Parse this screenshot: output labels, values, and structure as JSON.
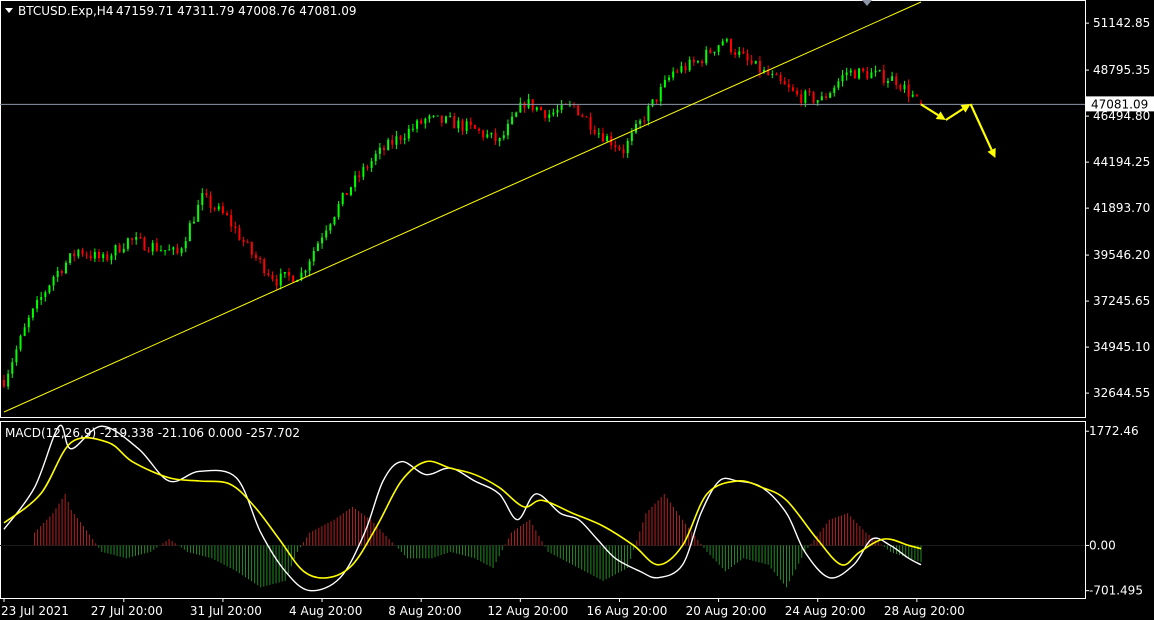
{
  "header": {
    "symbol": "BTCUSD.Exp,H4",
    "ohlc": "47159.71 47311.79 47008.76 47081.09"
  },
  "macd_header": "MACD(12,26,9) -219.338 -21.106 0.000 -257.702",
  "price_axis": {
    "ticks": [
      "51142.85",
      "48795.35",
      "46494.80",
      "44194.25",
      "41893.70",
      "39546.20",
      "37245.65",
      "34945.10",
      "32644.55"
    ],
    "current_price_label": "47081.09"
  },
  "macd_axis": {
    "ticks": [
      "1772.46",
      "0.00",
      "-701.495"
    ]
  },
  "time_axis": {
    "ticks": [
      "23 Jul 2021",
      "27 Jul 20:00",
      "31 Jul 20:00",
      "4 Aug 20:00",
      "8 Aug 20:00",
      "12 Aug 20:00",
      "16 Aug 20:00",
      "20 Aug 20:00",
      "24 Aug 20:00",
      "28 Aug 20:00"
    ]
  },
  "colors": {
    "background": "#000000",
    "bull_candle": "#00ff00",
    "bear_candle": "#ff0000",
    "trendline": "#ffff00",
    "forecast_arrow": "#ffff00",
    "macd_line": "#ffffff",
    "signal_line": "#ffff00",
    "hist_positive": "#b22222",
    "hist_negative": "#228b22",
    "price_line": "#8c96a8"
  },
  "chart_data": [
    {
      "type": "candlestick",
      "title": "BTCUSD.Exp,H4",
      "xlabel": "",
      "ylabel": "",
      "ylim": [
        31500,
        52200
      ],
      "timeframe": "H4",
      "x_range": [
        "23 Jul 2021",
        "29 Aug 2021"
      ],
      "current_price": 47081.09,
      "last_bar": {
        "open": 47159.71,
        "high": 47311.79,
        "low": 47008.76,
        "close": 47081.09
      },
      "trend_path": [
        [
          "23 Jul 2021",
          33300
        ],
        [
          "24 Jul 2021",
          36300
        ],
        [
          "25 Jul 2021",
          38500
        ],
        [
          "26 Jul 2021",
          39800
        ],
        [
          "27 Jul 2021",
          39300
        ],
        [
          "28 Jul 2021",
          40300
        ],
        [
          "29 Jul 2021",
          40000
        ],
        [
          "30 Jul 2021",
          39600
        ],
        [
          "31 Jul 2021",
          42400
        ],
        [
          "1 Aug 2021",
          41400
        ],
        [
          "2 Aug 2021",
          39600
        ],
        [
          "3 Aug 2021",
          38300
        ],
        [
          "4 Aug 2021",
          38600
        ],
        [
          "5 Aug 2021",
          41000
        ],
        [
          "6 Aug 2021",
          43000
        ],
        [
          "7 Aug 2021",
          44500
        ],
        [
          "8 Aug 2021",
          45500
        ],
        [
          "9 Aug 2021",
          46300
        ],
        [
          "10 Aug 2021",
          46200
        ],
        [
          "11 Aug 2021",
          45800
        ],
        [
          "12 Aug 2021",
          45200
        ],
        [
          "13 Aug 2021",
          47200
        ],
        [
          "14 Aug 2021",
          46600
        ],
        [
          "15 Aug 2021",
          47000
        ],
        [
          "16 Aug 2021",
          45700
        ],
        [
          "17 Aug 2021",
          44800
        ],
        [
          "18 Aug 2021",
          46800
        ],
        [
          "19 Aug 2021",
          48700
        ],
        [
          "20 Aug 2021",
          49200
        ],
        [
          "21 Aug 2021",
          50300
        ],
        [
          "22 Aug 2021",
          49200
        ],
        [
          "23 Aug 2021",
          48400
        ],
        [
          "24 Aug 2021",
          47500
        ],
        [
          "25 Aug 2021",
          47300
        ],
        [
          "26 Aug 2021",
          48700
        ],
        [
          "27 Aug 2021",
          48600
        ],
        [
          "28 Aug 2021",
          48300
        ],
        [
          "29 Aug 2021",
          47081
        ]
      ],
      "trendline": [
        [
          "23 Jul 2021",
          31700
        ],
        [
          "29 Aug 2021",
          52200
        ]
      ],
      "forecast_path": [
        [
          "29 Aug 2021",
          47081
        ],
        [
          "30 Aug 2021",
          46300
        ],
        [
          "31 Aug 2021",
          47100
        ],
        [
          "1 Sep 2021",
          44400
        ]
      ]
    },
    {
      "type": "line",
      "title": "MACD(12,26,9)",
      "xlabel": "",
      "ylabel": "",
      "ylim": [
        -800,
        1900
      ],
      "values": {
        "macd": -219.338,
        "signal": -21.106,
        "zero": 0.0,
        "histogram": -257.702
      },
      "series": [
        {
          "name": "MACD",
          "values": [
            [
              0,
              250
            ],
            [
              5,
              900
            ],
            [
              9,
              1850
            ],
            [
              11,
              1500
            ],
            [
              16,
              1850
            ],
            [
              22,
              1500
            ],
            [
              27,
              1000
            ],
            [
              32,
              1150
            ],
            [
              38,
              1050
            ],
            [
              42,
              200
            ],
            [
              46,
              -400
            ],
            [
              50,
              -700
            ],
            [
              55,
              -500
            ],
            [
              59,
              200
            ],
            [
              62,
              1000
            ],
            [
              65,
              1300
            ],
            [
              69,
              1100
            ],
            [
              73,
              1200
            ],
            [
              77,
              1000
            ],
            [
              81,
              800
            ],
            [
              84,
              400
            ],
            [
              87,
              800
            ],
            [
              91,
              500
            ],
            [
              94,
              400
            ],
            [
              97,
              100
            ],
            [
              100,
              -200
            ],
            [
              104,
              -400
            ],
            [
              107,
              -500
            ],
            [
              111,
              -300
            ],
            [
              114,
              500
            ],
            [
              117,
              1000
            ],
            [
              120,
              1000
            ],
            [
              124,
              900
            ],
            [
              128,
              500
            ],
            [
              131,
              -100
            ],
            [
              135,
              -500
            ],
            [
              139,
              -300
            ],
            [
              142,
              100
            ],
            [
              145,
              0
            ],
            [
              148,
              -200
            ],
            [
              150,
              -300
            ]
          ]
        },
        {
          "name": "Signal",
          "values": [
            [
              0,
              350
            ],
            [
              6,
              800
            ],
            [
              11,
              1600
            ],
            [
              17,
              1600
            ],
            [
              21,
              1300
            ],
            [
              27,
              1050
            ],
            [
              32,
              1000
            ],
            [
              37,
              950
            ],
            [
              41,
              600
            ],
            [
              45,
              100
            ],
            [
              49,
              -400
            ],
            [
              53,
              -500
            ],
            [
              57,
              -300
            ],
            [
              61,
              300
            ],
            [
              65,
              1000
            ],
            [
              69,
              1300
            ],
            [
              73,
              1200
            ],
            [
              77,
              1100
            ],
            [
              81,
              900
            ],
            [
              85,
              600
            ],
            [
              88,
              700
            ],
            [
              93,
              500
            ],
            [
              98,
              300
            ],
            [
              103,
              0
            ],
            [
              107,
              -300
            ],
            [
              111,
              0
            ],
            [
              115,
              800
            ],
            [
              120,
              1000
            ],
            [
              124,
              900
            ],
            [
              128,
              700
            ],
            [
              133,
              100
            ],
            [
              137,
              -300
            ],
            [
              140,
              -100
            ],
            [
              144,
              100
            ],
            [
              148,
              0
            ],
            [
              150,
              -50
            ]
          ]
        }
      ],
      "histogram": [
        [
          5,
          200
        ],
        [
          8,
          500
        ],
        [
          10,
          800
        ],
        [
          11,
          550
        ],
        [
          13,
          300
        ],
        [
          16,
          -100
        ],
        [
          20,
          -200
        ],
        [
          24,
          -100
        ],
        [
          27,
          100
        ],
        [
          30,
          -100
        ],
        [
          34,
          -200
        ],
        [
          38,
          -400
        ],
        [
          42,
          -650
        ],
        [
          46,
          -550
        ],
        [
          48,
          -100
        ],
        [
          50,
          200
        ],
        [
          54,
          400
        ],
        [
          57,
          600
        ],
        [
          60,
          400
        ],
        [
          63,
          100
        ],
        [
          66,
          -200
        ],
        [
          70,
          -200
        ],
        [
          73,
          -100
        ],
        [
          77,
          -200
        ],
        [
          80,
          -350
        ],
        [
          83,
          200
        ],
        [
          86,
          400
        ],
        [
          89,
          -100
        ],
        [
          94,
          -350
        ],
        [
          98,
          -550
        ],
        [
          102,
          -350
        ],
        [
          105,
          500
        ],
        [
          108,
          800
        ],
        [
          111,
          400
        ],
        [
          115,
          -100
        ],
        [
          118,
          -400
        ],
        [
          121,
          -200
        ],
        [
          125,
          -300
        ],
        [
          128,
          -650
        ],
        [
          131,
          -100
        ],
        [
          135,
          400
        ],
        [
          138,
          500
        ],
        [
          141,
          200
        ],
        [
          145,
          -100
        ],
        [
          148,
          -200
        ],
        [
          150,
          -257.702
        ]
      ]
    }
  ]
}
